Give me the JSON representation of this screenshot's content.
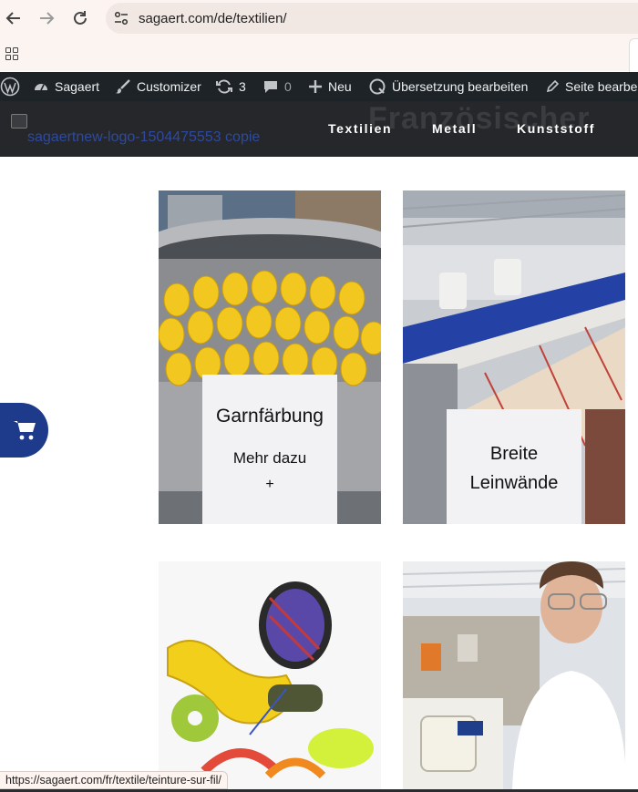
{
  "browser": {
    "url": "sagaert.com/de/textilien/",
    "status_url": "https://sagaert.com/fr/textile/teinture-sur-fil/",
    "icons": [
      "back-arrow-icon",
      "forward-arrow-icon",
      "reload-icon",
      "site-settings-icon",
      "apps-grid-icon"
    ]
  },
  "admin_bar": {
    "site": "Sagaert",
    "customizer": "Customizer",
    "updates": "3",
    "comments": "0",
    "new": "Neu",
    "translate": "Übersetzung bearbeiten",
    "edit_page": "Seite bearbeiten"
  },
  "header": {
    "logo_alt": "sagaertnew-logo-1504475553 copie",
    "background_title": "Französischer",
    "nav": [
      "Textilien",
      "Metall",
      "Kunststoff"
    ]
  },
  "cards": [
    {
      "title": "Garnfärbung",
      "more": "Mehr dazu",
      "plus": "+"
    },
    {
      "title_line1": "Breite",
      "title_line2": "Leinwände"
    }
  ],
  "colors": {
    "admin_bar": "#1d2327",
    "header": "#25272a",
    "cart_button": "#1e3a8a",
    "label_box": "#f2f1f4"
  }
}
